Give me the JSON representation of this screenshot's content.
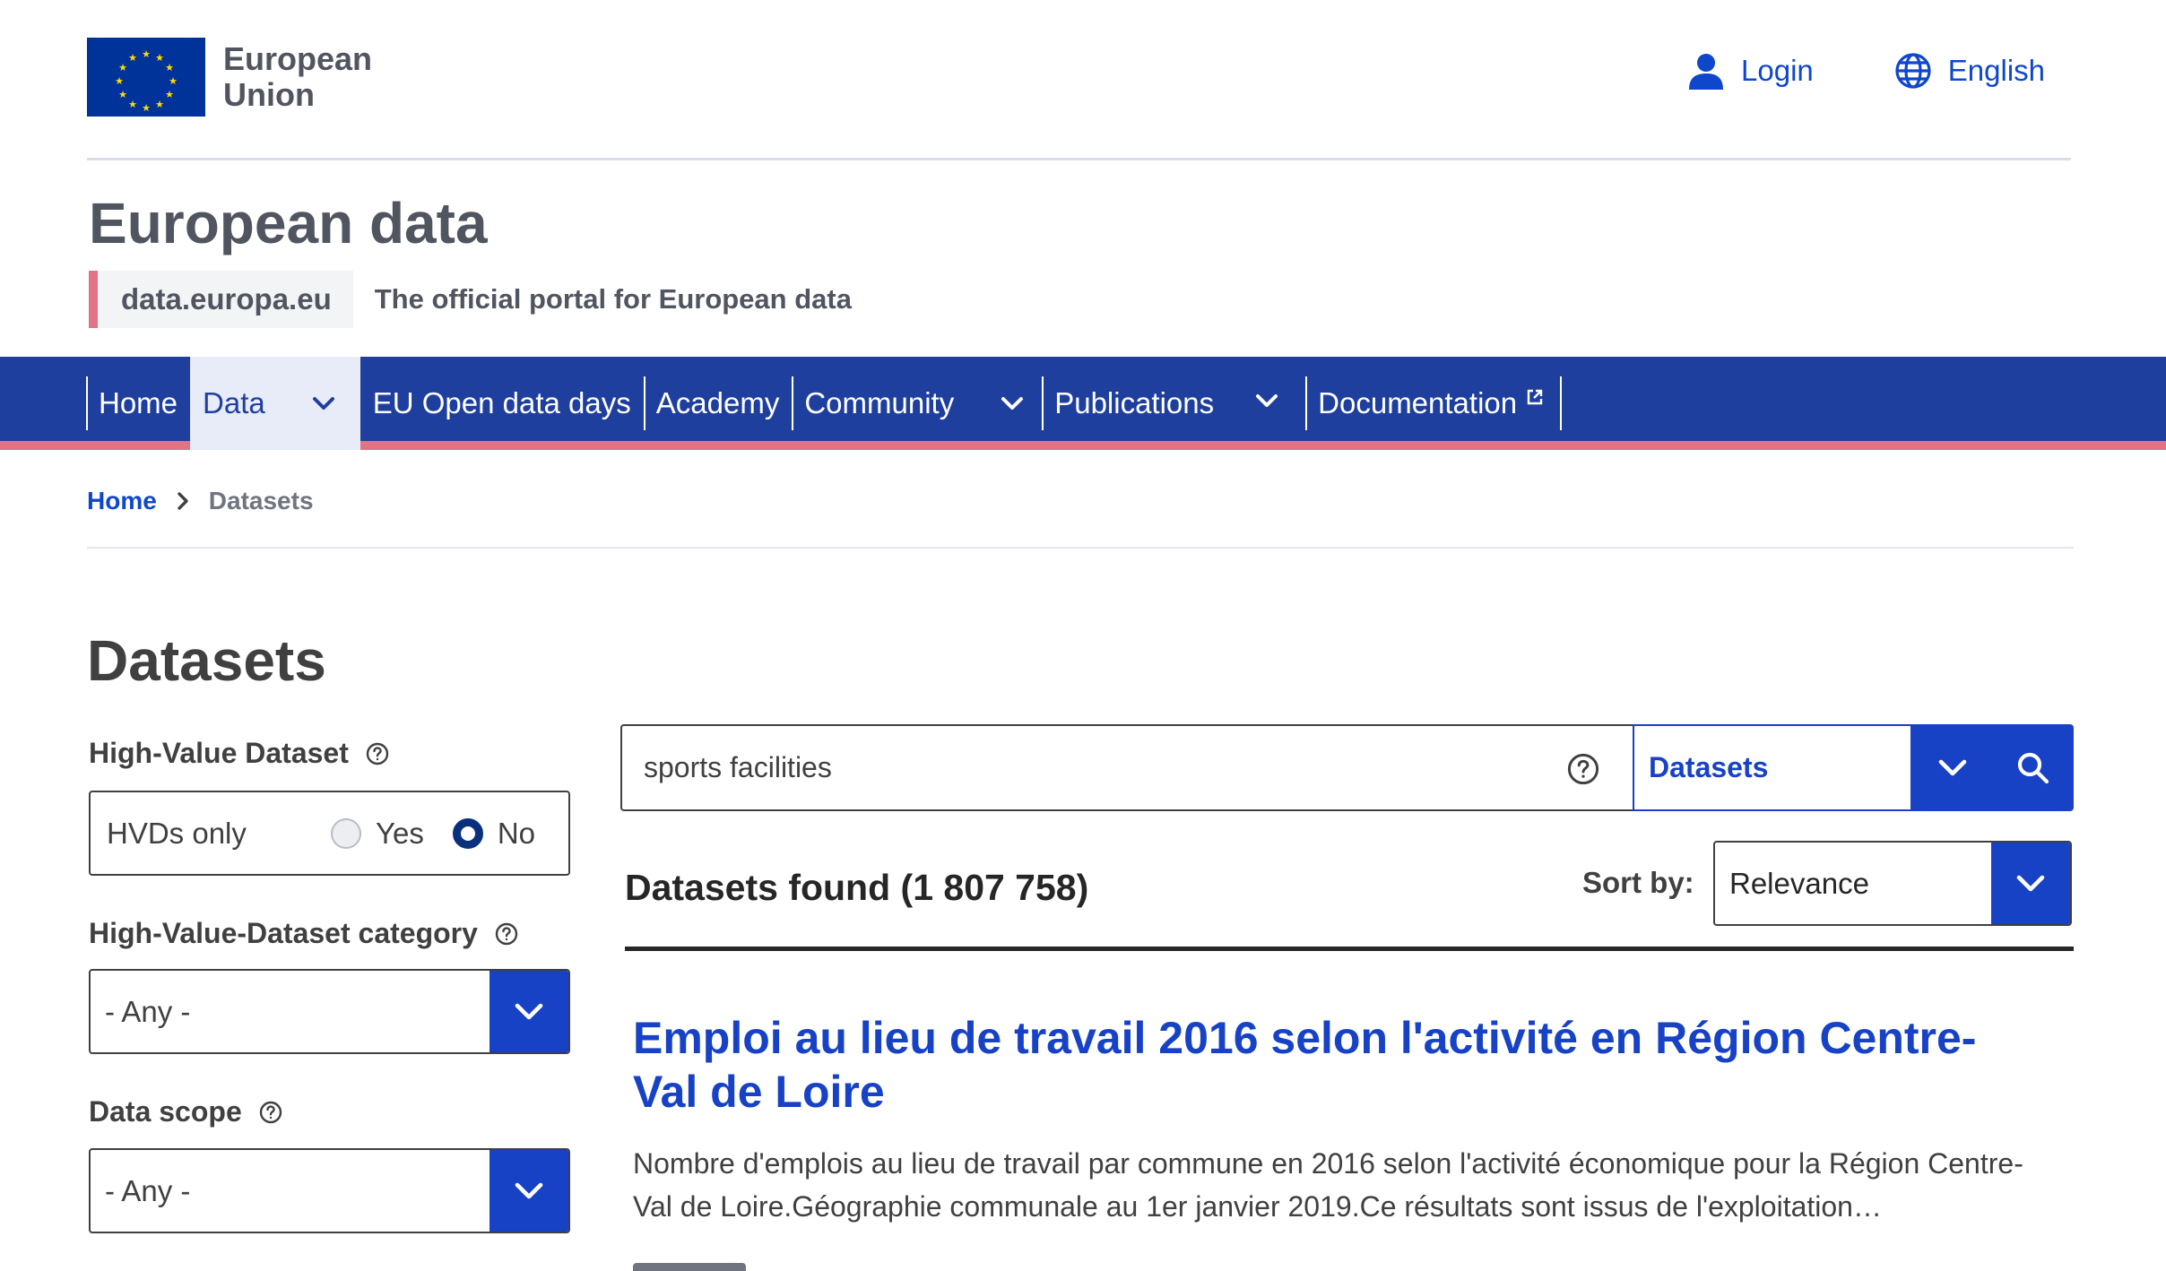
{
  "header": {
    "logo_line1": "European",
    "logo_line2": "Union",
    "login_label": "Login",
    "language_label": "English",
    "site_title": "European data",
    "site_id": "data.europa.eu",
    "tagline": "The official portal for European data"
  },
  "colors": {
    "eu_blue": "#003399",
    "eu_yellow": "#FFDD00",
    "nav_bg": "#1f3f9e",
    "accent_pink": "#e07386",
    "link_blue": "#0e47cb",
    "button_blue": "#1742c6"
  },
  "nav": {
    "items": [
      {
        "label": "Home",
        "has_dropdown": false,
        "active": false
      },
      {
        "label": "Data",
        "has_dropdown": true,
        "active": true
      },
      {
        "label": "EU Open data days",
        "has_dropdown": false,
        "active": false
      },
      {
        "label": "Academy",
        "has_dropdown": false,
        "active": false
      },
      {
        "label": "Community",
        "has_dropdown": true,
        "active": false
      },
      {
        "label": "Publications",
        "has_dropdown": true,
        "active": false
      },
      {
        "label": "Documentation",
        "has_dropdown": false,
        "external": true,
        "active": false
      }
    ]
  },
  "breadcrumb": {
    "home": "Home",
    "current": "Datasets"
  },
  "page": {
    "title": "Datasets"
  },
  "filters": {
    "hvd": {
      "label": "High-Value Dataset",
      "box_label": "HVDs only",
      "options": [
        {
          "label": "Yes",
          "selected": false
        },
        {
          "label": "No",
          "selected": true
        }
      ]
    },
    "hvd_category": {
      "label": "High-Value-Dataset category",
      "value": "- Any -"
    },
    "data_scope": {
      "label": "Data scope",
      "value": "- Any -"
    }
  },
  "search": {
    "query": "sports facilities",
    "scope": "Datasets",
    "icons": [
      "help-icon",
      "chevron-down-icon",
      "search-icon"
    ]
  },
  "results": {
    "count_text": "Datasets found (1 807 758)",
    "sort_label": "Sort by:",
    "sort_value": "Relevance",
    "items": [
      {
        "title": "Emploi au lieu de travail 2016 selon l'activité en Région Centre-Val de Loire",
        "description": "Nombre d'emplois au lieu de travail par commune en 2016 selon l'activité économique pour la Région Centre-Val de Loire.Géographie communale au 1er janvier 2019.Ce résultats sont issus de l'exploitation…"
      }
    ]
  }
}
